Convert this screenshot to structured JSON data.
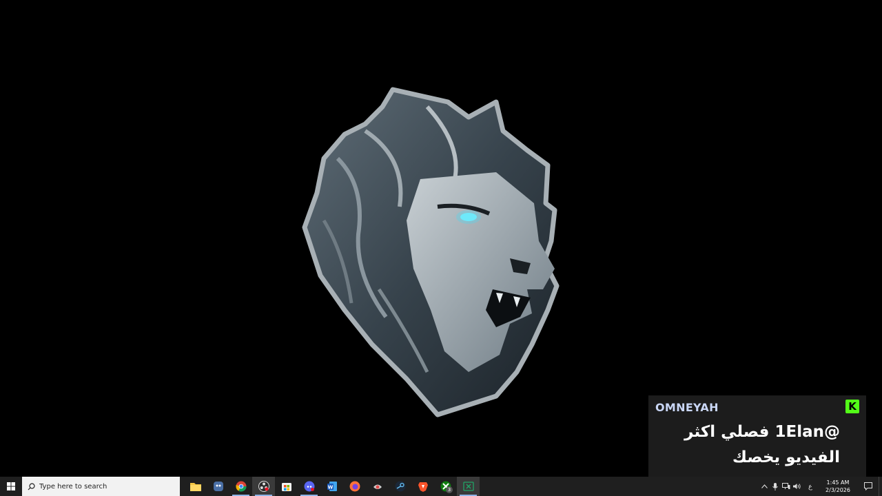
{
  "desktop": {
    "background_color": "#000000",
    "wallpaper": "lion-head-logo"
  },
  "chat_overlay": {
    "username": "OMNEYAH",
    "username_color": "#c9d6f5",
    "platform_icon": "kick-icon",
    "platform_icon_letter": "K",
    "platform_color": "#53fc18",
    "message": "@1Elan فصلي اكثر الفيديو يخصك"
  },
  "taskbar": {
    "search_placeholder": "Type here to search",
    "apps": [
      {
        "name": "file-explorer-icon",
        "color": "#f4c542"
      },
      {
        "name": "app-icon",
        "color": "#4a6fa5"
      },
      {
        "name": "chrome-icon",
        "color": "#34a853"
      },
      {
        "name": "obs-icon",
        "color": "#cccccc"
      },
      {
        "name": "microsoft-store-icon",
        "color": "#ffffff"
      },
      {
        "name": "discord-icon",
        "color": "#5865f2"
      },
      {
        "name": "word-icon",
        "color": "#2b579a"
      },
      {
        "name": "firefox-icon",
        "color": "#ff7139"
      },
      {
        "name": "app-icon",
        "color": "#d0d0d0"
      },
      {
        "name": "steam-icon",
        "color": "#66c0f4"
      },
      {
        "name": "brave-icon",
        "color": "#fb542b"
      },
      {
        "name": "xbox-icon",
        "color": "#107c10"
      },
      {
        "name": "excel-icon",
        "color": "#1d6f42"
      }
    ],
    "xbox_badge": "3",
    "tray": {
      "language": "ع",
      "time": "1:45 AM",
      "date": "2/3/2026"
    }
  }
}
